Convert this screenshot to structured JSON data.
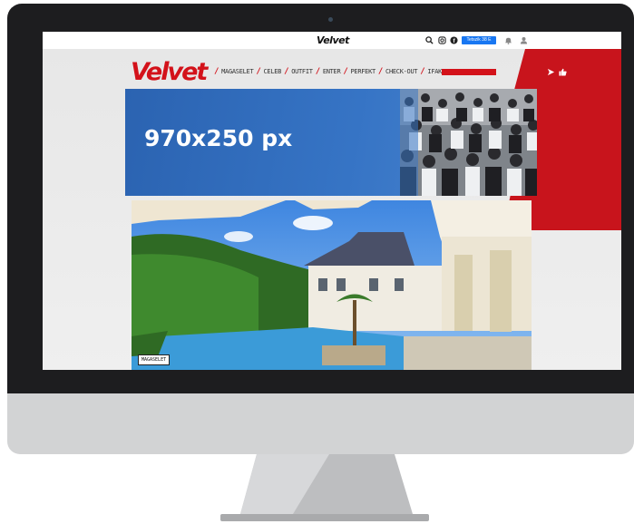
{
  "site": {
    "logo_text": "Velvet",
    "topbar_logo_text": "Velvet"
  },
  "topbar": {
    "icons": [
      "search-icon",
      "instagram-icon",
      "facebook-icon",
      "bell-icon",
      "user-icon"
    ],
    "facebook_like_label": "Tetszik 38 E"
  },
  "nav": {
    "items": [
      {
        "label": "MAGASELET"
      },
      {
        "label": "CELEB"
      },
      {
        "label": "OUTFIT"
      },
      {
        "label": "ENTER"
      },
      {
        "label": "PERFEKT"
      },
      {
        "label": "CHECK-OUT"
      },
      {
        "label": "IFAKTOR"
      }
    ],
    "icons": [
      "share-icon",
      "thumbs-up-icon"
    ]
  },
  "banner": {
    "text": "970x250 px"
  },
  "article": {
    "tag": "MAGASELET"
  },
  "colors": {
    "brand_red": "#d3121a",
    "banner_blue": "#2b63b1",
    "bezel": "#1d1d1f",
    "chin": "#d2d3d4"
  }
}
